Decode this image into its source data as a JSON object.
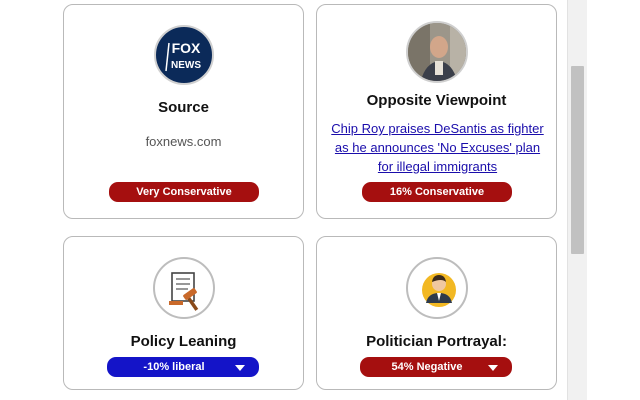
{
  "cards": {
    "source": {
      "logo_text": "FOX NEWS",
      "title": "Source",
      "domain": "foxnews.com",
      "badge": "Very Conservative"
    },
    "opposite": {
      "title": "Opposite Viewpoint",
      "link_text": "Chip Roy praises DeSantis as fighter as he announces 'No Excuses' plan for illegal immigrants",
      "badge": "16% Conservative"
    },
    "policy": {
      "title": "Policy Leaning",
      "dropdown_value": "-10% liberal"
    },
    "politician": {
      "title": "Politician Portrayal:",
      "dropdown_value": "54% Negative"
    }
  },
  "colors": {
    "conservative_red": "#a50f0f",
    "liberal_blue": "#1414c8",
    "link": "#1a0dab",
    "fox_blue": "#0b2a59"
  },
  "icons": {
    "source": "fox-news-logo",
    "opposite": "person-photo",
    "policy": "gavel-document-icon",
    "politician": "politician-icon"
  }
}
